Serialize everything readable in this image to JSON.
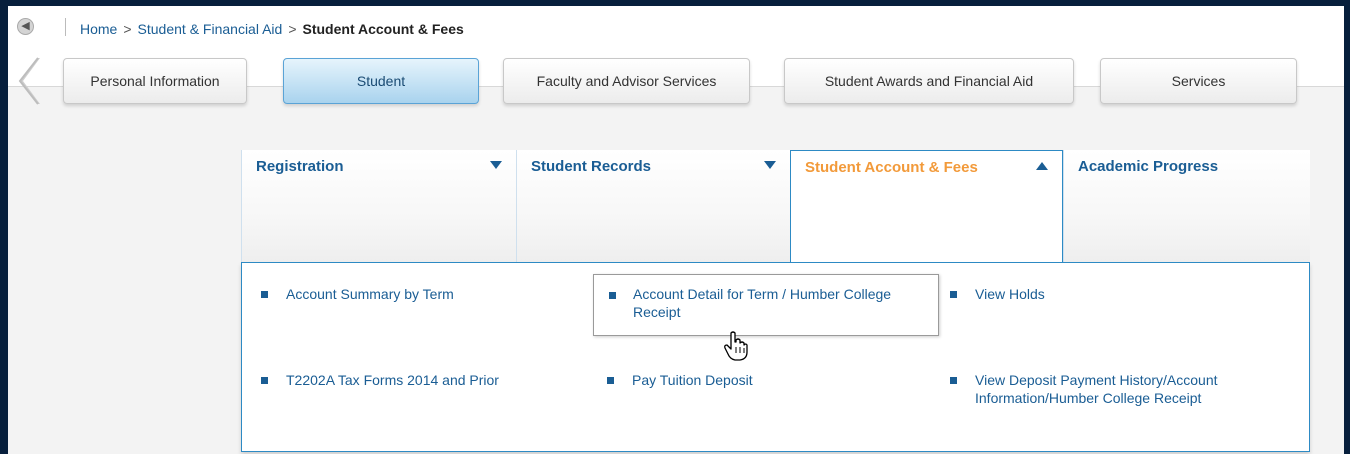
{
  "breadcrumb": {
    "home": "Home",
    "separator": ">",
    "level2": "Student & Financial Aid",
    "current": "Student Account & Fees"
  },
  "tabs": [
    {
      "label": "Personal Information",
      "active": false
    },
    {
      "label": "Student",
      "active": true
    },
    {
      "label": "Faculty and Advisor Services",
      "active": false
    },
    {
      "label": "Student Awards and Financial Aid",
      "active": false
    },
    {
      "label": "Services",
      "active": false
    }
  ],
  "menu": {
    "columns": [
      {
        "label": "Registration",
        "caret": "down"
      },
      {
        "label": "Student Records",
        "caret": "down"
      },
      {
        "label": "Student Account & Fees",
        "caret": "up",
        "open": true
      },
      {
        "label": "Academic Progress",
        "caret": "none"
      }
    ],
    "items": [
      {
        "label": "Account Summary by Term"
      },
      {
        "label": "Account Detail for Term / Humber College Receipt"
      },
      {
        "label": "View Holds"
      },
      {
        "label": "T2202A Tax Forms 2014 and Prior"
      },
      {
        "label": "Pay Tuition Deposit"
      },
      {
        "label": "View Deposit Payment History/Account Information/Humber College Receipt"
      }
    ]
  },
  "colors": {
    "link": "#1a5d94",
    "active_menu": "#f29a3a",
    "panel_border": "#2d8ac4",
    "outer_frame": "#071f3c"
  },
  "icons": {
    "back": "back-arrow-circle-icon",
    "left_scroll": "left-chevron-icon",
    "cursor": "hand-pointer-icon"
  }
}
